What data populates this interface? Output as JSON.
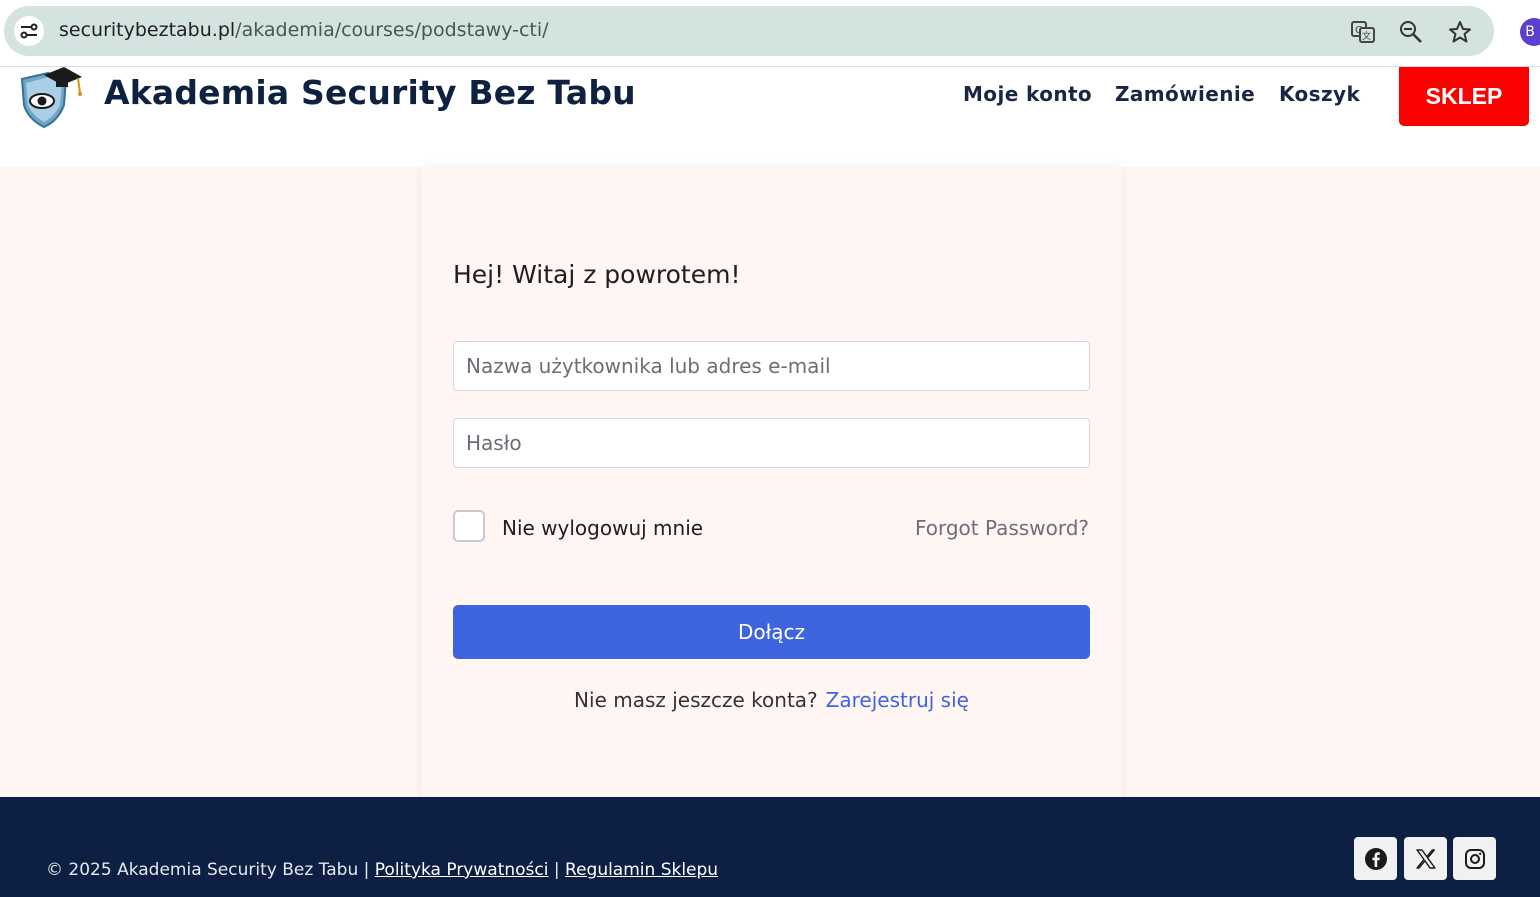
{
  "browser": {
    "url_domain": "securitybeztabu.pl",
    "url_path": "/akademia/courses/podstawy-cti/",
    "profile_initial": "B",
    "icons": [
      "site-info-icon",
      "translate-icon",
      "zoom-icon",
      "bookmark-star-icon"
    ]
  },
  "header": {
    "brand": "Akademia Security Bez Tabu",
    "nav": {
      "account": "Moje konto",
      "order": "Zamówienie",
      "cart": "Koszyk"
    },
    "shop_button": "SKLEP"
  },
  "login": {
    "heading": "Hej! Witaj z powrotem!",
    "username_placeholder": "Nazwa użytkownika lub adres e-mail",
    "password_placeholder": "Hasło",
    "remember_label": "Nie wylogowuj mnie",
    "forgot_label": "Forgot Password?",
    "submit_label": "Dołącz",
    "no_account_text": "Nie masz jeszcze konta?",
    "register_link": "Zarejestruj się"
  },
  "footer": {
    "copyright": "© 2025 Akademia Security Bez Tabu |",
    "privacy_link": "Polityka Prywatności",
    "separator": "|",
    "terms_link": "Regulamin Sklepu",
    "social": [
      "facebook-icon",
      "x-icon",
      "instagram-icon"
    ]
  },
  "colors": {
    "brand_navy": "#0d1f42",
    "shop_red": "#fd0000",
    "primary_blue": "#3e64de",
    "page_bg": "#fff6f4"
  }
}
